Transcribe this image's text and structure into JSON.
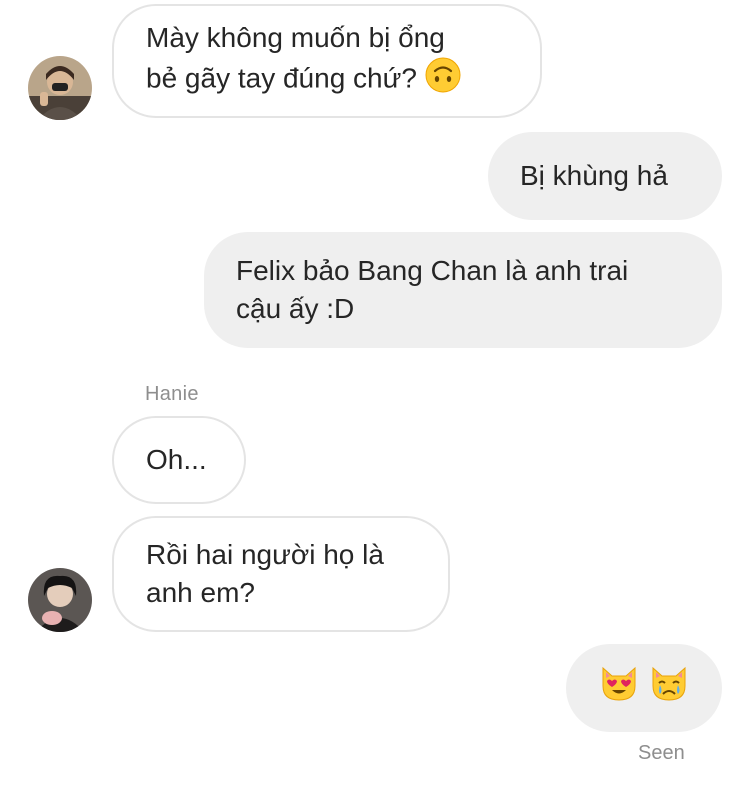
{
  "messages": {
    "m1": {
      "lines": [
        "Mày không muốn bị ổng",
        "bẻ gãy tay đúng chứ?"
      ],
      "emoji": "upside-down-face-emoji"
    },
    "m2": {
      "lines": [
        "Bị khùng hả"
      ]
    },
    "m3": {
      "lines": [
        "Felix bảo Bang Chan là anh trai",
        "cậu ấy :D"
      ]
    },
    "m4": {
      "lines": [
        "Oh..."
      ]
    },
    "m5": {
      "lines": [
        "Rồi hai người họ là",
        "anh em?"
      ]
    },
    "m6": {
      "emojis": [
        "heart-eyes-cat-emoji",
        "crying-cat-emoji"
      ]
    }
  },
  "sender_name": "Hanie",
  "status": {
    "seen": "Seen"
  },
  "colors": {
    "outgoing_bubble": "#efefef",
    "incoming_border": "#e4e4e4",
    "meta_text": "#8e8e8e",
    "emoji_yellow": "#ffcc33"
  }
}
